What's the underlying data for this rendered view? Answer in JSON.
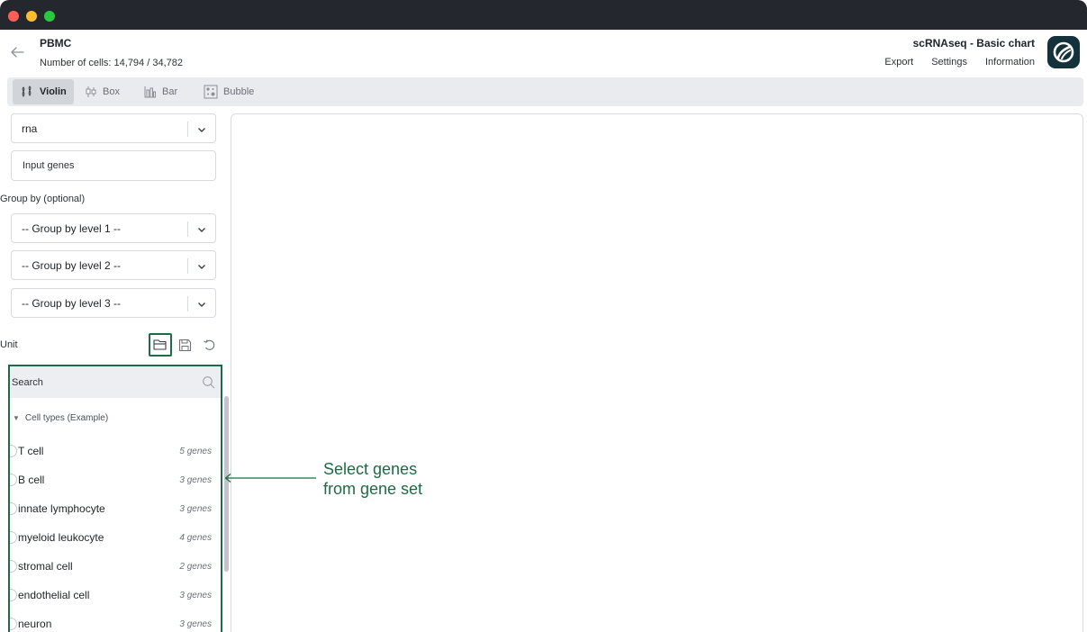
{
  "header": {
    "app_title": "PBMC",
    "cell_count": "Number of cells: 14,794 / 34,782",
    "page_title": "scRNAseq - Basic chart",
    "menu": [
      "Export",
      "Settings",
      "Information"
    ]
  },
  "toolbar": {
    "tabs": [
      {
        "label": "Violin",
        "icon": "violin-icon",
        "active": true
      },
      {
        "label": "Box",
        "icon": "box-plot-icon",
        "active": false
      },
      {
        "label": "Bar",
        "icon": "bar-chart-icon",
        "active": false
      },
      {
        "label": "Bubble",
        "icon": "bubble-chart-icon",
        "active": false
      }
    ]
  },
  "sidebar": {
    "assay_select": "rna",
    "genes_input_placeholder": "Input genes",
    "group_by_label": "Group by (optional)",
    "group_levels": [
      "-- Group by level 1 --",
      "-- Group by level 2 --",
      "-- Group by level 3 --"
    ],
    "unit_label": "Unit",
    "unit_icons": [
      "folder-open-icon",
      "save-icon",
      "reset-icon"
    ]
  },
  "geneset": {
    "search_placeholder": "Search",
    "group_title": "Cell types (Example)",
    "items": [
      {
        "name": "T cell",
        "count": "5 genes"
      },
      {
        "name": "B cell",
        "count": "3 genes"
      },
      {
        "name": "innate lymphocyte",
        "count": "3 genes"
      },
      {
        "name": "myeloid leukocyte",
        "count": "4 genes"
      },
      {
        "name": "stromal cell",
        "count": "2 genes"
      },
      {
        "name": "endothelial cell",
        "count": "3 genes"
      },
      {
        "name": "neuron",
        "count": "3 genes"
      }
    ]
  },
  "annotation": {
    "line1": "Select genes",
    "line2": "from gene set"
  },
  "colors": {
    "accent": "#1e6b45",
    "titlebar": "#24272e",
    "logo_bg": "#14323c"
  }
}
